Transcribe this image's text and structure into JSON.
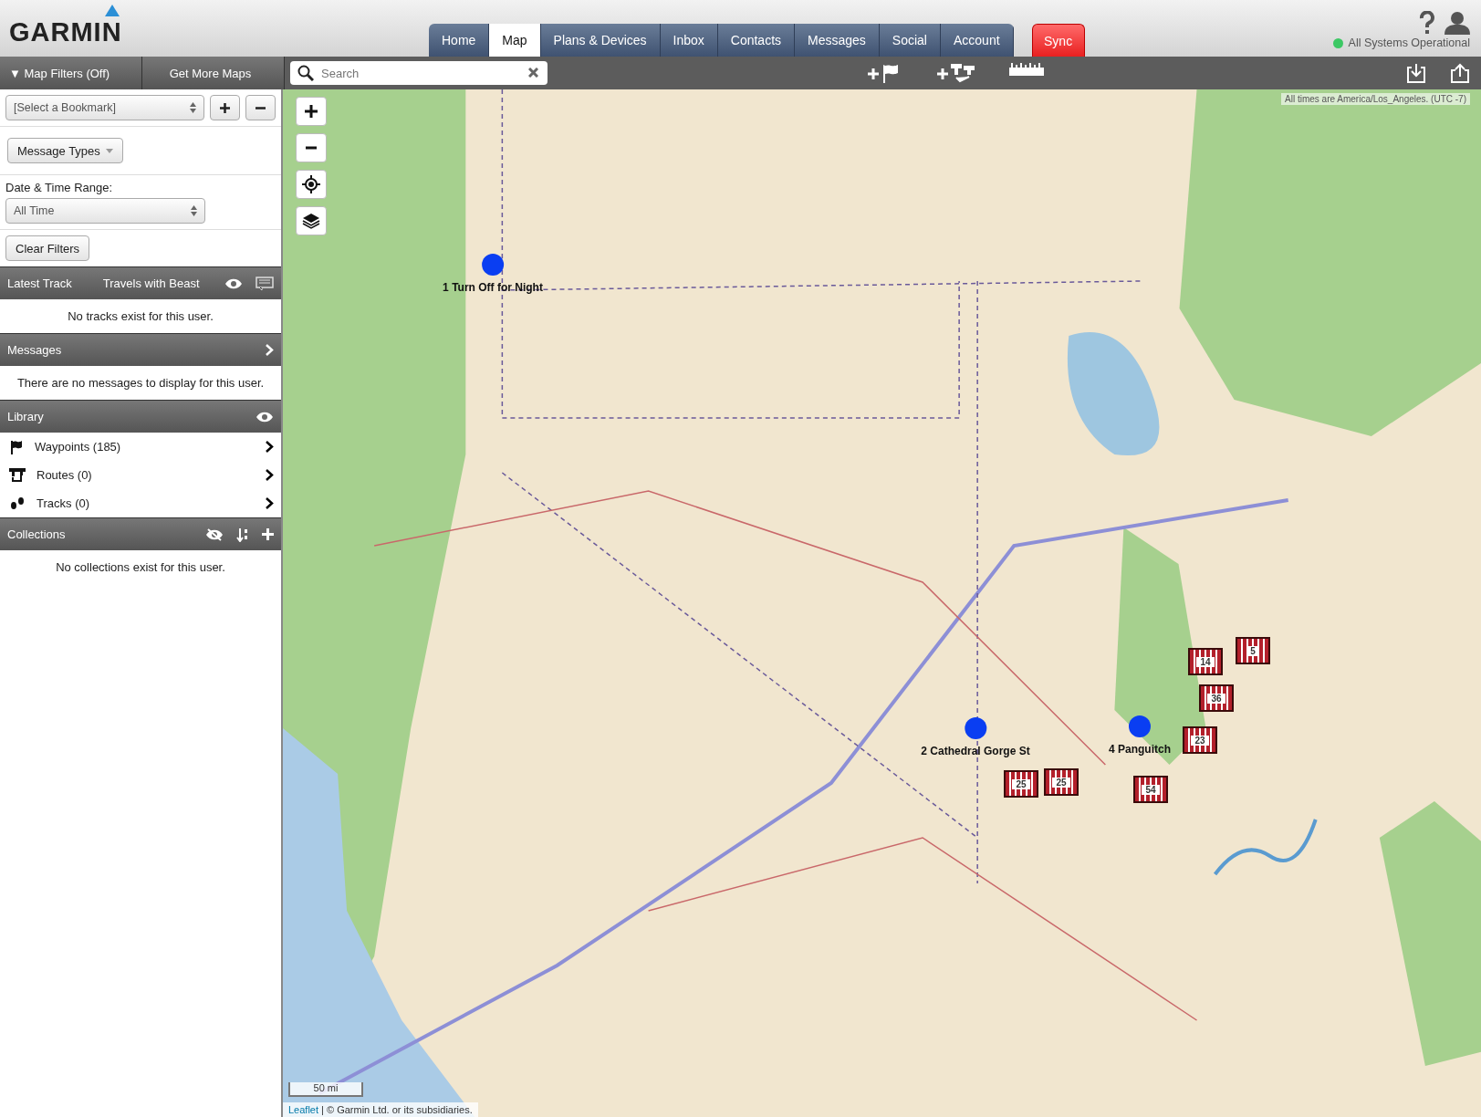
{
  "header": {
    "logo": "GARMIN",
    "nav": [
      {
        "label": "Home",
        "selected": false
      },
      {
        "label": "Map",
        "selected": true
      },
      {
        "label": "Plans & Devices",
        "selected": false
      },
      {
        "label": "Inbox",
        "selected": false
      },
      {
        "label": "Contacts",
        "selected": false
      },
      {
        "label": "Messages",
        "selected": false
      },
      {
        "label": "Social",
        "selected": false
      },
      {
        "label": "Account",
        "selected": false
      }
    ],
    "sync": "Sync",
    "status": {
      "text": "All Systems Operational",
      "color": "#3cc864"
    }
  },
  "sidebar": {
    "tabs": [
      "▼ Map Filters (Off)",
      "Get More Maps"
    ],
    "bookmark": "[Select a Bookmark]",
    "message_types": "Message Types",
    "date_label": "Date & Time Range:",
    "date_value": "All Time",
    "clear": "Clear Filters",
    "sections": [
      {
        "title": "Latest Track",
        "subtitle": "Travels with Beast",
        "kind": "track",
        "empty": "No tracks exist for this user."
      },
      {
        "title": "Messages",
        "kind": "messages",
        "empty": "There are no messages to display for this user."
      },
      {
        "title": "Library",
        "kind": "library",
        "items": [
          {
            "label": "Waypoints (185)",
            "kind": "waypoints"
          },
          {
            "label": "Routes (0)",
            "kind": "routes"
          },
          {
            "label": "Tracks (0)",
            "kind": "tracks"
          }
        ]
      },
      {
        "title": "Collections",
        "kind": "collections",
        "empty": "No collections exist for this user."
      }
    ]
  },
  "map": {
    "search": {
      "placeholder": "Search"
    },
    "timezone": "All times are America/Los_Angeles. (UTC -7)",
    "markers": [
      {
        "label": "1 Turn Off for Night"
      },
      {
        "label": "2 Cathedral Gorge St"
      },
      {
        "label": "4 Panguitch"
      }
    ],
    "clusters": [
      "14",
      "5",
      "36",
      "23",
      "25",
      "25",
      "54"
    ],
    "scale": "50 mi",
    "attribution_link": "Leaflet",
    "attribution": "| © Garmin Ltd. or its subsidiaries."
  }
}
